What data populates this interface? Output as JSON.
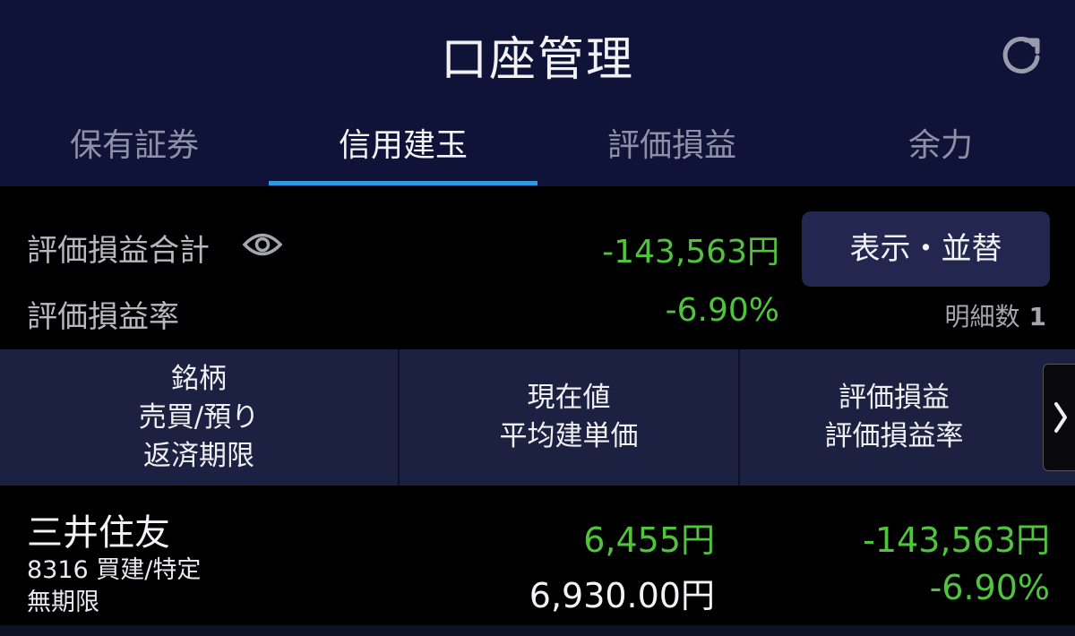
{
  "header": {
    "title": "口座管理",
    "refresh_icon": "refresh-icon"
  },
  "tabs": [
    {
      "label": "保有証券",
      "active": false
    },
    {
      "label": "信用建玉",
      "active": true
    },
    {
      "label": "評価損益",
      "active": false
    },
    {
      "label": "余力",
      "active": false
    }
  ],
  "summary": {
    "total_label": "評価損益合計",
    "total_value": "-143,563円",
    "rate_label": "評価損益率",
    "rate_value": "-6.90%",
    "display_button": "表示・並替",
    "count_label": "明細数",
    "count_value": "1"
  },
  "table": {
    "headers": [
      {
        "lines": [
          "銘柄",
          "売買/預り",
          "返済期限"
        ]
      },
      {
        "lines": [
          "現在値",
          "平均建単価"
        ]
      },
      {
        "lines": [
          "評価損益",
          "評価損益率"
        ]
      }
    ],
    "rows": [
      {
        "name": "三井住友",
        "code_info": "8316 買建/特定",
        "deadline": "無期限",
        "current_price": "6,455円",
        "avg_price": "6,930.00円",
        "pl": "-143,563円",
        "pl_rate": "-6.90%"
      }
    ]
  },
  "colors": {
    "header_bg": "#101338",
    "accent_underline": "#2f98e0",
    "positive_green": "#4fc43c",
    "table_header_bg": "#1d2141"
  }
}
